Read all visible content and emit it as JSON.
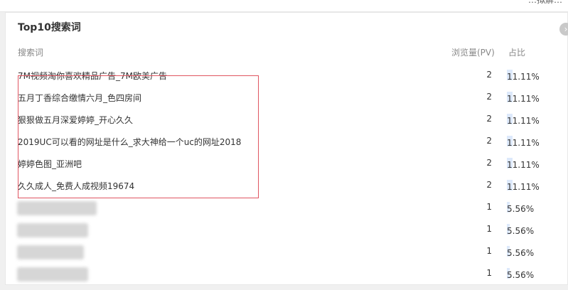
{
  "topbar": {
    "text": "…拟解…"
  },
  "panel": {
    "title": "Top10搜索词",
    "columns": {
      "term": "搜索词",
      "pv": "浏览量(PV)",
      "ratio": "占比"
    },
    "rows": [
      {
        "term": "7M视频淘你喜欢精品广告_7M欧美广告",
        "pv": "2",
        "ratio": "11.11%",
        "ratio_value": 0.1111
      },
      {
        "term": "五月丁香综合缴情六月_色四房间",
        "pv": "2",
        "ratio": "11.11%",
        "ratio_value": 0.1111
      },
      {
        "term": "狠狠做五月深爱婷婷_开心久久",
        "pv": "2",
        "ratio": "11.11%",
        "ratio_value": 0.1111
      },
      {
        "term": "2019UC可以看的网址是什么_求大神给一个uc的网址2018",
        "pv": "2",
        "ratio": "11.11%",
        "ratio_value": 0.1111
      },
      {
        "term": "婷婷色图_亚洲吧",
        "pv": "2",
        "ratio": "11.11%",
        "ratio_value": 0.1111
      },
      {
        "term": "久久成人_免费人成视频19674",
        "pv": "2",
        "ratio": "11.11%",
        "ratio_value": 0.1111
      },
      {
        "term": "",
        "pv": "1",
        "ratio": "5.56%",
        "ratio_value": 0.0556,
        "blurred": true
      },
      {
        "term": "",
        "pv": "1",
        "ratio": "5.56%",
        "ratio_value": 0.0556,
        "blurred": true
      },
      {
        "term": "",
        "pv": "1",
        "ratio": "5.56%",
        "ratio_value": 0.0556,
        "blurred": true
      },
      {
        "term": "",
        "pv": "1",
        "ratio": "5.56%",
        "ratio_value": 0.0556,
        "blurred": true
      }
    ]
  }
}
